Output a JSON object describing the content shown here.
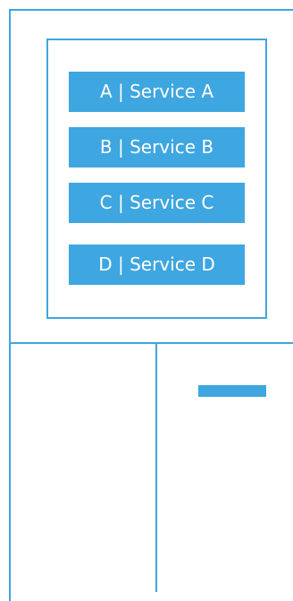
{
  "services": [
    {
      "label": "A | Service A"
    },
    {
      "label": "B | Service B"
    },
    {
      "label": "C | Service C"
    },
    {
      "label": "D | Service D"
    }
  ],
  "colors": {
    "accent": "#3ea6e0",
    "background": "#ffffff",
    "button_text": "#ffffff"
  }
}
